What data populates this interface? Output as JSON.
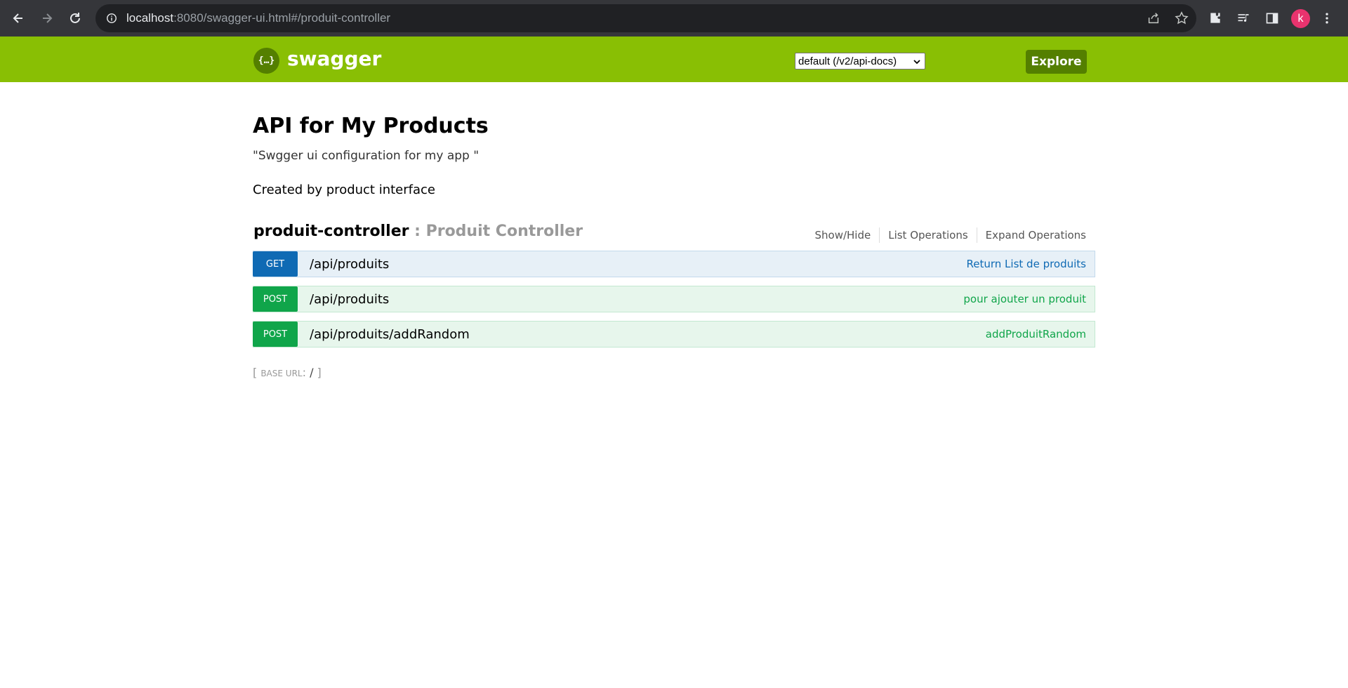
{
  "browser": {
    "url_host": "localhost",
    "url_rest": ":8080/swagger-ui.html#/produit-controller",
    "profile_initial": "k"
  },
  "header": {
    "logo_text": "{…}",
    "title": "swagger",
    "spec_select": "default (/v2/api-docs)",
    "explore_label": "Explore"
  },
  "api": {
    "title": "API for My Products",
    "description": "\"Swgger ui configuration for my app \"",
    "created": "Created by product interface"
  },
  "controller": {
    "name": "produit-controller",
    "separator": " : ",
    "description": "Produit Controller",
    "actions": [
      "Show/Hide",
      "List Operations",
      "Expand Operations"
    ]
  },
  "operations": [
    {
      "method": "GET",
      "path": "/api/produits",
      "summary": "Return List de produits"
    },
    {
      "method": "POST",
      "path": "/api/produits",
      "summary": "pour ajouter un produit"
    },
    {
      "method": "POST",
      "path": "/api/produits/addRandom",
      "summary": "addProduitRandom"
    }
  ],
  "base_url": {
    "open": "[ ",
    "label": "base url",
    "colon": ": ",
    "value": "/",
    "close": " ]"
  },
  "colors": {
    "header_green": "#89bf04",
    "get_blue": "#0f6ab4",
    "post_green": "#10a54a"
  }
}
